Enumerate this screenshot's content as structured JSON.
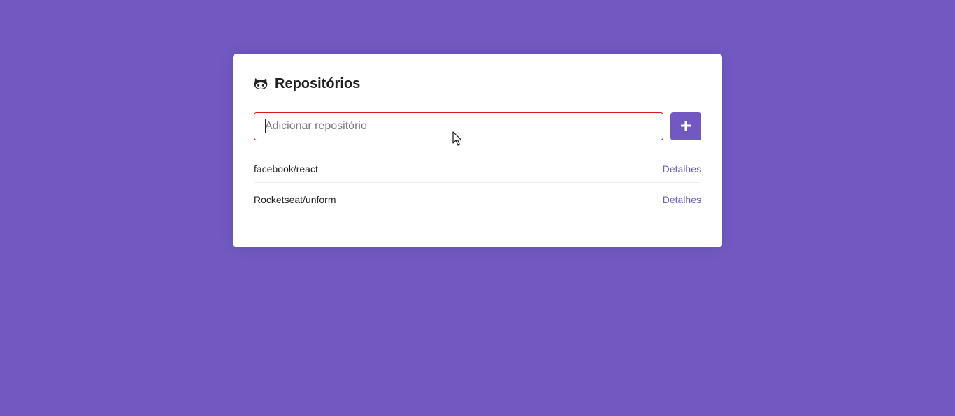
{
  "header": {
    "icon": "github-icon",
    "title": "Repositórios"
  },
  "form": {
    "input_placeholder": "Adicionar repositório",
    "input_value": "",
    "add_button_icon": "plus-icon",
    "error_border_color": "#d41a1a"
  },
  "repositories": [
    {
      "name": "facebook/react",
      "link_label": "Detalhes"
    },
    {
      "name": "Rocketseat/unform",
      "link_label": "Detalhes"
    }
  ],
  "colors": {
    "background": "#7159c1",
    "accent": "#7159c1",
    "card": "#ffffff"
  }
}
